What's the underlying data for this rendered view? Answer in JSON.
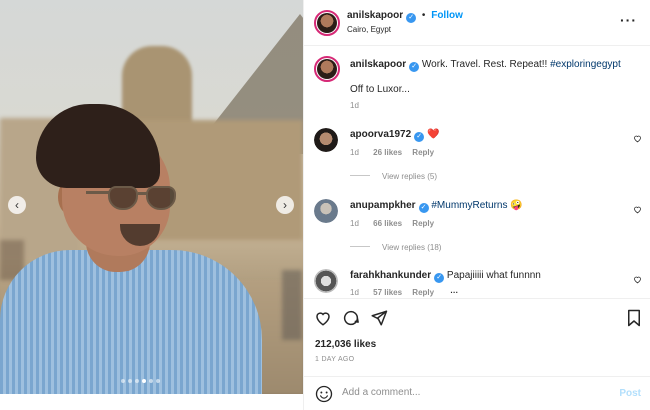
{
  "photo": {
    "nav_prev_glyph": "‹",
    "nav_next_glyph": "›",
    "slide_count": 6,
    "active_slide": 3
  },
  "header": {
    "username": "anilskapoor",
    "verified_glyph": "✓",
    "separator": "•",
    "follow_label": "Follow",
    "location": "Cairo, Egypt",
    "more_glyph": "···"
  },
  "caption": {
    "username": "anilskapoor",
    "text": "Work. Travel. Rest. Repeat!!",
    "hashtag": "#exploringegypt",
    "line2": "Off to Luxor...",
    "time": "1d"
  },
  "comments": [
    {
      "username": "apoorva1972",
      "text_before": "",
      "tag": "",
      "text_after": "❤️",
      "time": "1d",
      "likes": "26 likes",
      "reply": "Reply",
      "view_replies": "View replies (5)"
    },
    {
      "username": "anupampkher",
      "text_before": "",
      "tag": "#MummyReturns",
      "text_after": "🤪",
      "time": "1d",
      "likes": "66 likes",
      "reply": "Reply",
      "view_replies": "View replies (18)"
    },
    {
      "username": "farahkhankunder",
      "text_before": "Papajiiiii what funnnn",
      "tag": "",
      "text_after": "",
      "time": "1d",
      "likes": "57 likes",
      "reply": "Reply",
      "more": "···"
    }
  ],
  "actions": {
    "likes": "212,036 likes",
    "time_ago": "1 DAY AGO"
  },
  "comment_bar": {
    "placeholder": "Add a comment...",
    "post_label": "Post"
  },
  "colors": {
    "link_blue": "#0095f6",
    "verified_blue": "#3897f0",
    "heart_red": "#ed4956",
    "muted": "#8e8e8e"
  }
}
